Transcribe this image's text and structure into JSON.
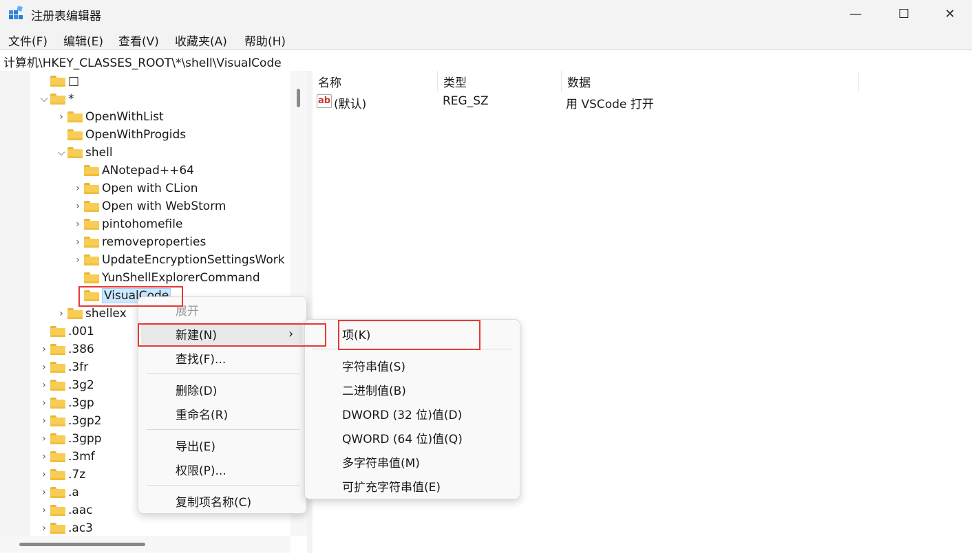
{
  "window": {
    "title": "注册表编辑器",
    "minimize_glyph": "—",
    "maximize_glyph": "☐",
    "close_glyph": "✕"
  },
  "menubar": {
    "items": [
      "文件(F)",
      "编辑(E)",
      "查看(V)",
      "收藏夹(A)",
      "帮助(H)"
    ]
  },
  "address": {
    "path": "计算机\\HKEY_CLASSES_ROOT\\*\\shell\\VisualCode"
  },
  "tree": {
    "items": [
      {
        "label": "□",
        "chevron": ""
      },
      {
        "label": "*",
        "chevron": "⌵"
      },
      {
        "label": "OpenWithList",
        "chevron": "›"
      },
      {
        "label": "OpenWithProgids",
        "chevron": ""
      },
      {
        "label": "shell",
        "chevron": "⌵"
      },
      {
        "label": "ANotepad++64",
        "chevron": ""
      },
      {
        "label": "Open with CLion",
        "chevron": "›"
      },
      {
        "label": "Open with WebStorm",
        "chevron": "›"
      },
      {
        "label": "pintohomefile",
        "chevron": "›"
      },
      {
        "label": "removeproperties",
        "chevron": "›"
      },
      {
        "label": "UpdateEncryptionSettingsWork",
        "chevron": "›"
      },
      {
        "label": "YunShellExplorerCommand",
        "chevron": ""
      },
      {
        "label": "VisualCode",
        "chevron": ""
      },
      {
        "label": "shellex",
        "chevron": "›"
      },
      {
        "label": ".001",
        "chevron": ""
      },
      {
        "label": ".386",
        "chevron": "›"
      },
      {
        "label": ".3fr",
        "chevron": "›"
      },
      {
        "label": ".3g2",
        "chevron": "›"
      },
      {
        "label": ".3gp",
        "chevron": "›"
      },
      {
        "label": ".3gp2",
        "chevron": "›"
      },
      {
        "label": ".3gpp",
        "chevron": "›"
      },
      {
        "label": ".3mf",
        "chevron": "›"
      },
      {
        "label": ".7z",
        "chevron": "›"
      },
      {
        "label": ".a",
        "chevron": "›"
      },
      {
        "label": ".aac",
        "chevron": "›"
      },
      {
        "label": ".ac3",
        "chevron": "›"
      }
    ]
  },
  "values": {
    "headers": {
      "name": "名称",
      "type": "类型",
      "data": "数据"
    },
    "rows": [
      {
        "icon_text": "ab",
        "name": "(默认)",
        "type": "REG_SZ",
        "data": "用 VSCode 打开"
      }
    ]
  },
  "context_menu": {
    "expand": "展开",
    "new": "新建(N)",
    "new_arrow": "›",
    "find": "查找(F)...",
    "delete": "删除(D)",
    "rename": "重命名(R)",
    "export": "导出(E)",
    "permissions": "权限(P)...",
    "copy_key_name": "复制项名称(C)"
  },
  "submenu": {
    "key": "项(K)",
    "string": "字符串值(S)",
    "binary": "二进制值(B)",
    "dword": "DWORD (32 位)值(D)",
    "qword": "QWORD (64 位)值(Q)",
    "multi_string": "多字符串值(M)",
    "expand_string": "可扩充字符串值(E)"
  },
  "colors": {
    "highlight_border": "#e53935",
    "selection": "#cce8ff",
    "folder": "#f7cd55"
  }
}
